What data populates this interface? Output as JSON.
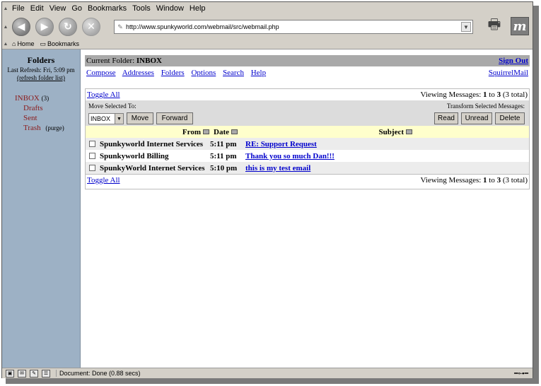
{
  "menubar": {
    "items": [
      "File",
      "Edit",
      "View",
      "Go",
      "Bookmarks",
      "Tools",
      "Window",
      "Help"
    ]
  },
  "navbar": {
    "url": "http://www.spunkyworld.com/webmail/src/webmail.php"
  },
  "personal_toolbar": {
    "home_label": "Home",
    "bookmarks_label": "Bookmarks"
  },
  "sidebar": {
    "title": "Folders",
    "last_refresh": "Last Refresh: Fri, 5:09 pm",
    "refresh_link": "(refresh folder list)",
    "inbox_label": "INBOX",
    "inbox_count": "(3)",
    "folders": [
      "Drafts",
      "Sent",
      "Trash"
    ],
    "purge_label": "(purge)"
  },
  "main": {
    "current_folder_label": "Current Folder:",
    "current_folder": "INBOX",
    "sign_out": "Sign Out",
    "nav_links": [
      "Compose",
      "Addresses",
      "Folders",
      "Options",
      "Search",
      "Help"
    ],
    "squirrelmail_link": "SquirrelMail",
    "toggle_all": "Toggle All",
    "viewing_prefix": "Viewing Messages:",
    "viewing_from": "1",
    "viewing_to_word": "to",
    "viewing_to": "3",
    "viewing_total": "(3 total)",
    "move_selected_label": "Move Selected To:",
    "transform_label": "Transform Selected Messages:",
    "folder_select_value": "INBOX",
    "move_button": "Move",
    "forward_button": "Forward",
    "read_button": "Read",
    "unread_button": "Unread",
    "delete_button": "Delete",
    "columns": {
      "from": "From",
      "date": "Date",
      "subject": "Subject"
    },
    "messages": [
      {
        "from": "Spunkyworld Internet Services",
        "date": "5:11 pm",
        "subject": "RE: Support Request"
      },
      {
        "from": "Spunkyworld Billing",
        "date": "5:11 pm",
        "subject": "Thank you so much Dan!!!"
      },
      {
        "from": "SpunkyWorld Internet Services",
        "date": "5:10 pm",
        "subject": "this is my test email"
      }
    ]
  },
  "statusbar": {
    "text": "Document: Done (0.88 secs)"
  },
  "colors": {
    "sidebar_bg": "#9db1c5",
    "folder_link": "#8b1a1a",
    "link_blue": "#0000cc",
    "header_gray": "#a9a9a9",
    "column_header_bg": "#ffffcc"
  }
}
